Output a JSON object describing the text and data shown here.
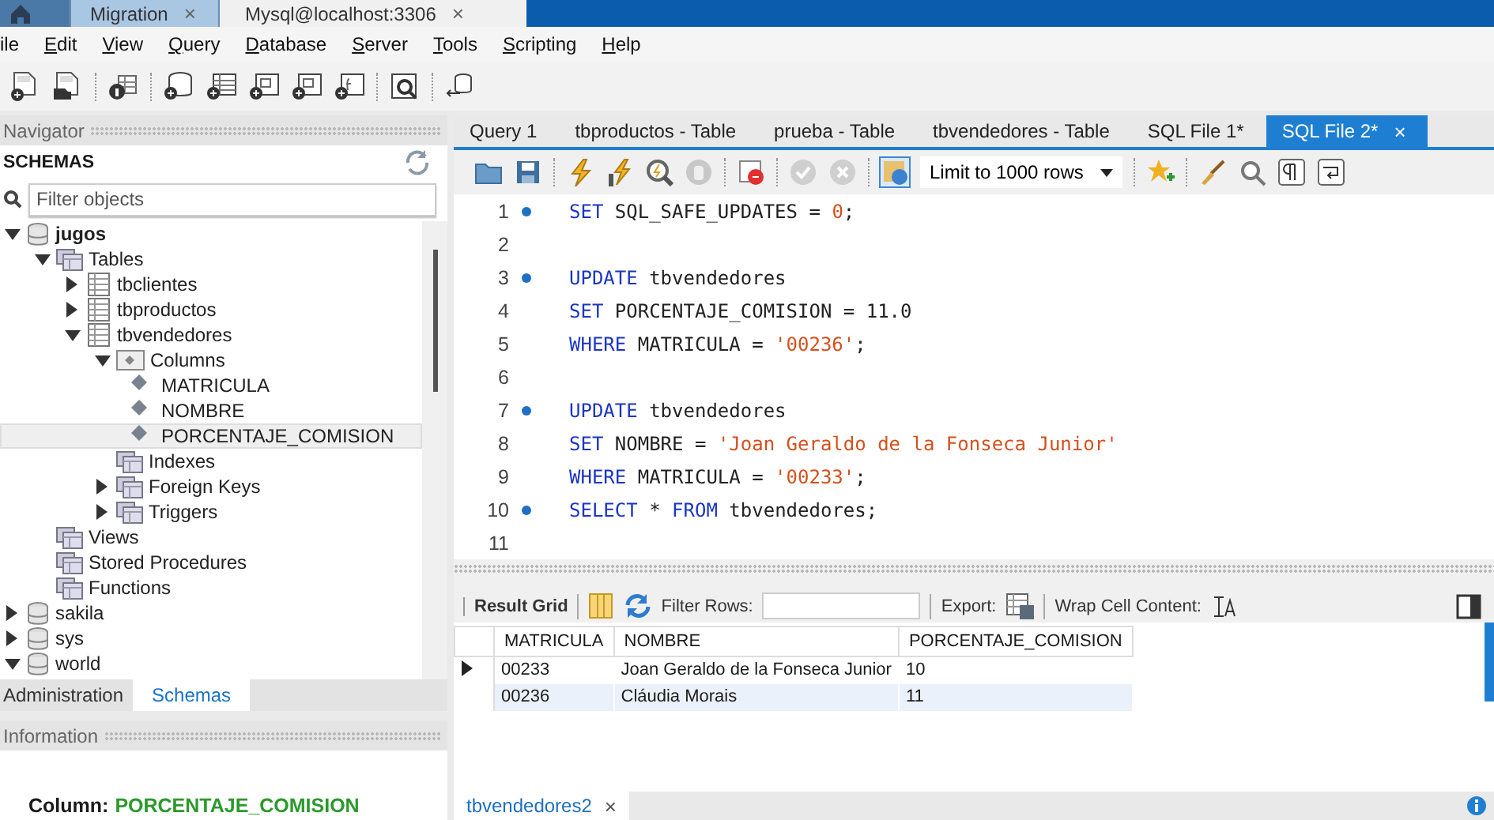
{
  "connection_tabs": [
    {
      "kind": "home",
      "selected": false
    },
    {
      "kind": "tab",
      "label": "Migration",
      "close": "×",
      "selected": false
    },
    {
      "kind": "tab",
      "label": "Mysql@localhost:3306",
      "close": "×",
      "selected": true
    }
  ],
  "menu": [
    {
      "label": "ile",
      "mnemonic": false
    },
    {
      "label": "Edit",
      "mnemonic": true
    },
    {
      "label": "View",
      "mnemonic": true
    },
    {
      "label": "Query",
      "mnemonic": true
    },
    {
      "label": "Database",
      "mnemonic": true
    },
    {
      "label": "Server",
      "mnemonic": true
    },
    {
      "label": "Tools",
      "mnemonic": true
    },
    {
      "label": "Scripting",
      "mnemonic": true
    },
    {
      "label": "Help",
      "mnemonic": true
    }
  ],
  "navigator": {
    "title": "Navigator",
    "section": "SCHEMAS",
    "filter": {
      "placeholder": "Filter objects"
    },
    "tree": [
      {
        "label": "jugos",
        "kind": "schema",
        "expanded": true,
        "selected": false,
        "children": [
          {
            "label": "Tables",
            "kind": "folder",
            "expanded": true,
            "selected": false,
            "children": [
              {
                "label": "tbclientes",
                "kind": "table",
                "expanded": false,
                "selected": false
              },
              {
                "label": "tbproductos",
                "kind": "table",
                "expanded": false,
                "selected": false
              },
              {
                "label": "tbvendedores",
                "kind": "table",
                "expanded": true,
                "selected": false,
                "children": [
                  {
                    "label": "Columns",
                    "kind": "columns",
                    "expanded": true,
                    "selected": false,
                    "children": [
                      {
                        "label": "MATRICULA",
                        "kind": "column",
                        "selected": false
                      },
                      {
                        "label": "NOMBRE",
                        "kind": "column",
                        "selected": false
                      },
                      {
                        "label": "PORCENTAJE_COMISION",
                        "kind": "column",
                        "selected": true
                      }
                    ]
                  },
                  {
                    "label": "Indexes",
                    "kind": "folder",
                    "selected": false
                  },
                  {
                    "label": "Foreign Keys",
                    "kind": "folder",
                    "expanded": false,
                    "selected": false
                  },
                  {
                    "label": "Triggers",
                    "kind": "folder",
                    "expanded": false,
                    "selected": false
                  }
                ]
              }
            ]
          },
          {
            "label": "Views",
            "kind": "folder",
            "selected": false
          },
          {
            "label": "Stored Procedures",
            "kind": "folder",
            "selected": false
          },
          {
            "label": "Functions",
            "kind": "folder",
            "selected": false
          }
        ]
      },
      {
        "label": "sakila",
        "kind": "schema",
        "expanded": false,
        "selected": false
      },
      {
        "label": "sys",
        "kind": "schema",
        "expanded": false,
        "selected": false
      },
      {
        "label": "world",
        "kind": "schema",
        "expanded": true,
        "selected": false
      }
    ],
    "bottom_tabs": [
      {
        "label": "Administration",
        "selected": false
      },
      {
        "label": "Schemas",
        "selected": true
      }
    ]
  },
  "information": {
    "title": "Information",
    "label": "Column:",
    "value": "PORCENTAJE_COMISION"
  },
  "editor_tabs": [
    {
      "label": "Query 1",
      "selected": false
    },
    {
      "label": "tbproductos - Table",
      "selected": false
    },
    {
      "label": "prueba - Table",
      "selected": false
    },
    {
      "label": "tbvendedores - Table",
      "selected": false
    },
    {
      "label": "SQL File 1*",
      "selected": false
    },
    {
      "label": "SQL File 2*",
      "selected": true,
      "close": "×"
    }
  ],
  "limit": "Limit to 1000 rows",
  "code": [
    {
      "number": "1",
      "marker": true,
      "tokens": [
        {
          "text": "SET",
          "kind": "keyword"
        },
        {
          "text": " SQL_SAFE_UPDATES = ",
          "kind": "plain"
        },
        {
          "text": "0",
          "kind": "number"
        },
        {
          "text": ";",
          "kind": "plain"
        }
      ]
    },
    {
      "number": "2",
      "marker": false
    },
    {
      "number": "3",
      "marker": true,
      "tokens": [
        {
          "text": "UPDATE",
          "kind": "keyword"
        },
        {
          "text": " tbvendedores",
          "kind": "plain"
        }
      ]
    },
    {
      "number": "4",
      "marker": false,
      "tokens": [
        {
          "text": "SET",
          "kind": "keyword"
        },
        {
          "text": " PORCENTAJE_COMISION = 11.0",
          "kind": "plain"
        }
      ]
    },
    {
      "number": "5",
      "marker": false,
      "tokens": [
        {
          "text": "WHERE",
          "kind": "keyword"
        },
        {
          "text": " MATRICULA = ",
          "kind": "plain"
        },
        {
          "text": "'00236'",
          "kind": "string"
        },
        {
          "text": ";",
          "kind": "plain"
        }
      ]
    },
    {
      "number": "6",
      "marker": false
    },
    {
      "number": "7",
      "marker": true,
      "tokens": [
        {
          "text": "UPDATE",
          "kind": "keyword"
        },
        {
          "text": " tbvendedores",
          "kind": "plain"
        }
      ]
    },
    {
      "number": "8",
      "marker": false,
      "tokens": [
        {
          "text": "SET",
          "kind": "keyword"
        },
        {
          "text": " NOMBRE = ",
          "kind": "plain"
        },
        {
          "text": "'Joan Geraldo de la Fonseca Junior'",
          "kind": "string"
        }
      ]
    },
    {
      "number": "9",
      "marker": false,
      "tokens": [
        {
          "text": "WHERE",
          "kind": "keyword"
        },
        {
          "text": " MATRICULA = ",
          "kind": "plain"
        },
        {
          "text": "'00233'",
          "kind": "string"
        },
        {
          "text": ";",
          "kind": "plain"
        }
      ]
    },
    {
      "number": "10",
      "marker": true,
      "tokens": [
        {
          "text": "SELECT",
          "kind": "keyword"
        },
        {
          "text": " * ",
          "kind": "plain"
        },
        {
          "text": "FROM",
          "kind": "keyword"
        },
        {
          "text": " tbvendedores;",
          "kind": "plain"
        }
      ]
    },
    {
      "number": "11",
      "marker": false
    }
  ],
  "result_toolbar": {
    "result_grid": "Result Grid",
    "filter_label": "Filter Rows:",
    "export_label": "Export:",
    "wrap_label": "Wrap Cell Content:"
  },
  "result": {
    "columns": [
      "MATRICULA",
      "NOMBRE",
      "PORCENTAJE_COMISION"
    ],
    "rows": [
      {
        "current": true,
        "cells": [
          "00233",
          "Joan Geraldo de la Fonseca Junior",
          "10"
        ]
      },
      {
        "current": false,
        "cells": [
          "00236",
          "Cláudia Morais",
          "11"
        ]
      }
    ]
  },
  "result_tabs": [
    {
      "label": "tbvendedores2",
      "close": "×",
      "selected": true
    }
  ]
}
